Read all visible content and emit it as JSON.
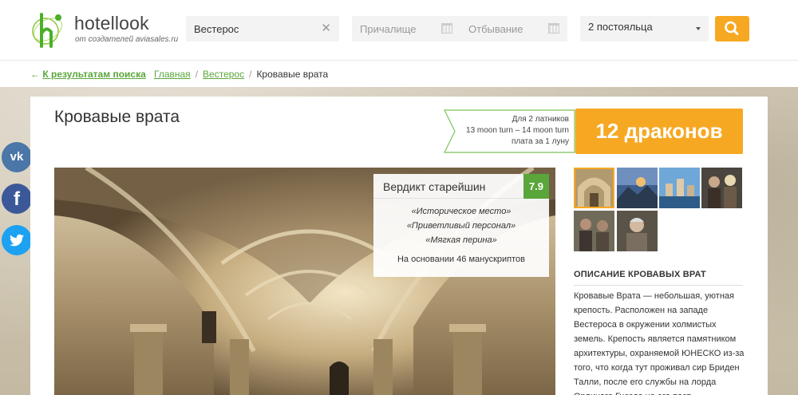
{
  "header": {
    "logo_name": "hotellook",
    "logo_sub": "от создателей aviasales.ru",
    "destination": "Вестерос",
    "checkin_placeholder": "Причалище",
    "checkout_placeholder": "Отбывание",
    "guests": "2 постояльца"
  },
  "crumbs": {
    "back_arrow": "←",
    "back_label": "К результатам поиска",
    "home": "Главная",
    "region": "Вестерос",
    "sep": "/",
    "current": "Кровавые врата"
  },
  "social": {
    "vk": "vk",
    "fb": "f"
  },
  "hotel": {
    "title": "Кровавые врата",
    "price_for": "Для 2 латников",
    "price_dates": "13 moon turn – 14 moon turn",
    "price_per": "плата за 1 луну",
    "price": "12 драконов"
  },
  "rating": {
    "label": "Вердикт старейшин",
    "score": "7.9",
    "quotes": [
      "«Историческое место»",
      "«Приветливый персонал»",
      "«Мягкая перина»"
    ],
    "footer": "На основании 46 манускриптов"
  },
  "description": {
    "title": "ОПИСАНИЕ КРОВАВЫХ ВРАТ",
    "text": "Кровавые Врата — небольшая, уютная крепость. Расположен на западе Вестероса в окружении холмистых земель. Крепость является памятником архитектуры, охраняемой ЮНЕСКО из-за того, что когда тут проживал сир Бриден Талли, после его службы на лорда Орлиного Гнезда на его пост"
  },
  "colors": {
    "accent": "#f7a823",
    "brand_green": "#5aa63b"
  }
}
